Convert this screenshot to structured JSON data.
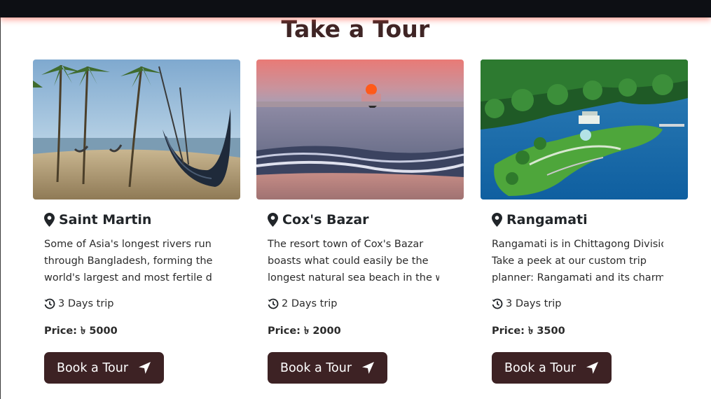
{
  "section_title": "Take a Tour",
  "tours": [
    {
      "place": "Saint Martin",
      "description": [
        "Some of Asia's longest rivers run",
        "through Bangladesh, forming the",
        "world's largest and most fertile d"
      ],
      "duration": "3 Days trip",
      "price_label": "Price:",
      "price_value": "৳ 5000",
      "button_label": "Book a Tour"
    },
    {
      "place": "Cox's Bazar",
      "description": [
        "The resort town of Cox's Bazar",
        "boasts what could easily be the",
        "longest natural sea beach in the worl"
      ],
      "duration": "2 Days trip",
      "price_label": "Price:",
      "price_value": "৳ 2000",
      "button_label": "Book a Tour"
    },
    {
      "place": "Rangamati",
      "description": [
        "Rangamati is in Chittagong Division.",
        "Take a peek at our custom trip",
        "planner: Rangamati and its charm"
      ],
      "duration": "3 Days trip",
      "price_label": "Price:",
      "price_value": "৳ 3500",
      "button_label": "Book a Tour"
    }
  ],
  "colors": {
    "button_bg": "#3d2224",
    "title": "#3f2525",
    "topbar": "#0d0f14"
  },
  "icons": {
    "location": "map-marker-icon",
    "duration": "history-icon",
    "book": "location-arrow-icon"
  }
}
